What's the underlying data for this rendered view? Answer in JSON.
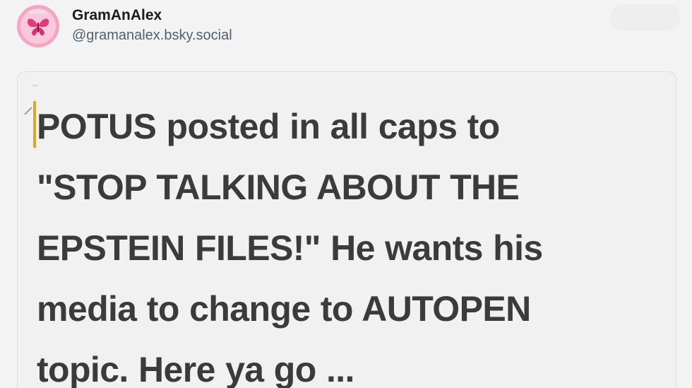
{
  "author": {
    "display_name": "GramAnAlex",
    "handle": "@gramanalex.bsky.social",
    "avatar_text": "SOCIAL",
    "avatar_icon": "butterfly-icon",
    "avatar_colors": {
      "outer": "#f4a6c3",
      "inner": "#f9c8da",
      "butterfly": "#e23a7c"
    }
  },
  "image_text": {
    "lines": [
      "POTUS posted in all caps to",
      "\"STOP TALKING ABOUT THE",
      "EPSTEIN FILES!\" He wants his",
      "media to change to AUTOPEN",
      "topic. Here ya go ..."
    ]
  },
  "colors": {
    "background": "#f3f3f3",
    "text": "#3b3b3b",
    "cursor_accent": "#d9a72a"
  }
}
